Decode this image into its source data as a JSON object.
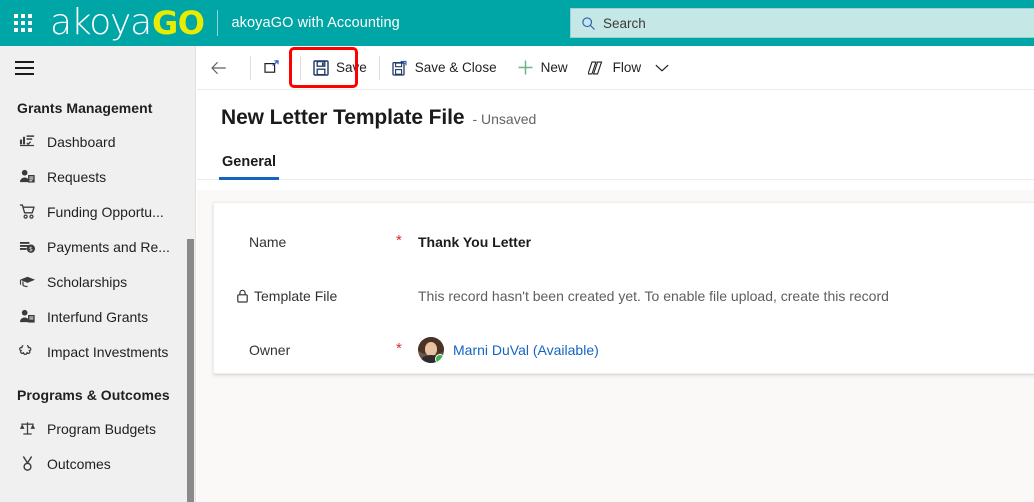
{
  "header": {
    "waffle_icon": "app-launcher-icon",
    "logo_primary": "akoya",
    "logo_accent": "GO",
    "app_name": "akoyaGO with Accounting",
    "search_placeholder": "Search",
    "search_value": "",
    "search_icon": "search-icon",
    "bg_color": "#00a5a5",
    "accent_color": "#e8ec00",
    "search_bg": "#c5e8e6"
  },
  "sidebar": {
    "hamburger_icon": "hamburger-icon",
    "groups": [
      {
        "title": "Grants Management",
        "items": [
          {
            "label": "Dashboard",
            "icon": "dashboard-icon"
          },
          {
            "label": "Requests",
            "icon": "requests-icon"
          },
          {
            "label": "Funding Opportu...",
            "icon": "cart-icon"
          },
          {
            "label": "Payments and Re...",
            "icon": "payments-icon"
          },
          {
            "label": "Scholarships",
            "icon": "graduation-cap-icon"
          },
          {
            "label": "Interfund Grants",
            "icon": "people-icon"
          },
          {
            "label": "Impact Investments",
            "icon": "puzzle-icon"
          }
        ]
      },
      {
        "title": "Programs & Outcomes",
        "items": [
          {
            "label": "Program Budgets",
            "icon": "scales-icon"
          },
          {
            "label": "Outcomes",
            "icon": "medal-icon"
          }
        ]
      }
    ]
  },
  "command_bar": {
    "back": {
      "label": "",
      "icon": "back-arrow-icon"
    },
    "popout": {
      "label": "",
      "icon": "popout-icon"
    },
    "save": {
      "label": "Save",
      "icon": "save-icon",
      "highlighted": true,
      "highlight_color": "#ff0000"
    },
    "save_close": {
      "label": "Save & Close",
      "icon": "save-and-close-icon"
    },
    "new": {
      "label": "New",
      "icon": "plus-icon",
      "icon_color": "#6db48a"
    },
    "flow": {
      "label": "Flow",
      "icon": "flow-icon"
    },
    "flow_chevron": {
      "icon": "chevron-down-icon"
    }
  },
  "record": {
    "title": "New Letter Template File",
    "state": "- Unsaved",
    "tabs": [
      {
        "label": "General",
        "active": true
      }
    ],
    "fields": [
      {
        "label": "Name",
        "required": true,
        "required_marker": "*",
        "locked": false,
        "value": "Thank You Letter",
        "style": "bold"
      },
      {
        "label": "Template File",
        "required": false,
        "required_marker": "",
        "locked": true,
        "lock_icon": "lock-icon",
        "value": "This record hasn't been created yet. To enable file upload, create this record",
        "style": "muted"
      },
      {
        "label": "Owner",
        "required": true,
        "required_marker": "*",
        "locked": false,
        "value": "Marni DuVal (Available)",
        "style": "link",
        "avatar": "user-avatar",
        "presence": "available",
        "presence_color": "#39b54a",
        "link_color": "#1664c0"
      }
    ]
  }
}
